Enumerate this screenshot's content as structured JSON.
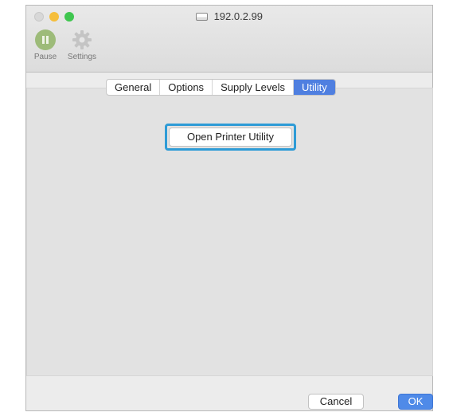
{
  "window": {
    "title": "192.0.2.99"
  },
  "toolbar": {
    "pause_label": "Pause",
    "settings_label": "Settings"
  },
  "tabs": [
    {
      "label": "General",
      "active": false
    },
    {
      "label": "Options",
      "active": false
    },
    {
      "label": "Supply Levels",
      "active": false
    },
    {
      "label": "Utility",
      "active": true
    }
  ],
  "utility": {
    "open_button_label": "Open Printer Utility"
  },
  "footer": {
    "cancel_label": "Cancel",
    "ok_label": "OK"
  },
  "colors": {
    "accent": "#4f7fe0",
    "focus_ring": "#2e9bd6",
    "pause_green": "#9dbb79"
  }
}
